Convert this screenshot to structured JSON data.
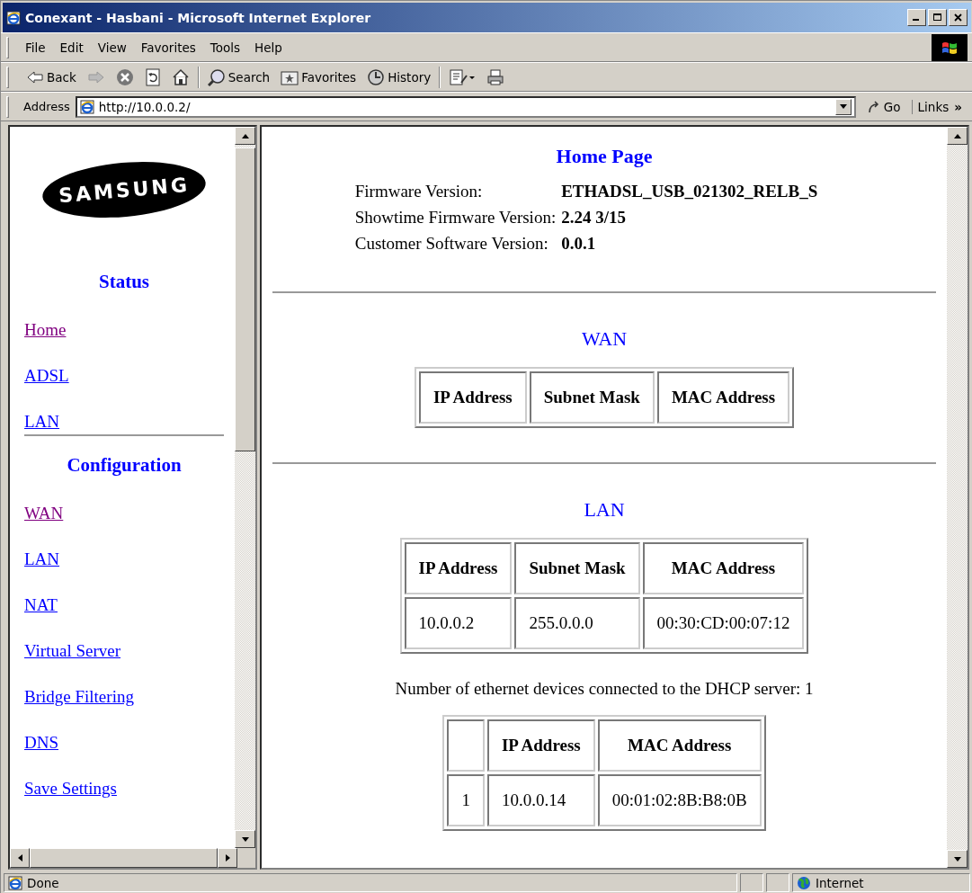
{
  "window": {
    "title": "Conexant - Hasbani - Microsoft Internet Explorer"
  },
  "menu": [
    "File",
    "Edit",
    "View",
    "Favorites",
    "Tools",
    "Help"
  ],
  "toolbar": [
    {
      "kind": "back",
      "label": "Back"
    },
    {
      "kind": "forward"
    },
    {
      "kind": "stop"
    },
    {
      "kind": "refresh"
    },
    {
      "kind": "home"
    },
    {
      "kind": "search",
      "label": "Search"
    },
    {
      "kind": "favorites",
      "label": "Favorites"
    },
    {
      "kind": "history",
      "label": "History"
    },
    {
      "kind": "edit"
    },
    {
      "kind": "print"
    }
  ],
  "address": {
    "label": "Address",
    "value": "http://10.0.0.2/",
    "go": "Go",
    "links": "Links",
    "links_chevron": "»"
  },
  "sidebar": {
    "logo": "SAMSUNG",
    "sections": [
      {
        "heading": "Status",
        "items": [
          {
            "label": "Home",
            "visited": true
          },
          {
            "label": "ADSL",
            "visited": false
          },
          {
            "label": "LAN",
            "visited": false
          }
        ]
      },
      {
        "heading": "Configuration",
        "items": [
          {
            "label": "WAN",
            "visited": true
          },
          {
            "label": "LAN",
            "visited": false
          },
          {
            "label": "NAT",
            "visited": false
          },
          {
            "label": "Virtual Server",
            "visited": false
          },
          {
            "label": "Bridge Filtering",
            "visited": false
          },
          {
            "label": "DNS",
            "visited": false
          },
          {
            "label": "Save Settings",
            "visited": false
          }
        ]
      }
    ]
  },
  "main": {
    "title": "Home Page",
    "info": [
      {
        "label": "Firmware Version:",
        "value": "ETHADSL_USB_021302_RELB_S"
      },
      {
        "label": "Showtime Firmware Version:",
        "value": "2.24 3/15"
      },
      {
        "label": "Customer Software Version:",
        "value": "0.0.1"
      }
    ],
    "sections": [
      {
        "heading": "WAN",
        "tables": [
          {
            "columns": [
              "IP Address",
              "Subnet Mask",
              "MAC Address"
            ]
          }
        ]
      },
      {
        "heading": "LAN",
        "tables": [
          {
            "columns": [
              "IP Address",
              "Subnet Mask",
              "MAC Address"
            ],
            "rows": [
              {
                "cells": [
                  "10.0.0.2",
                  "255.0.0.0",
                  "00:30:CD:00:07:12"
                ]
              }
            ]
          },
          {
            "note": "Number of ethernet devices connected to the DHCP server: 1",
            "columns": [
              "IP Address",
              "MAC Address"
            ],
            "rows": [
              {
                "index": "1",
                "cells": [
                  "10.0.0.14",
                  "00:01:02:8B:B8:0B"
                ]
              }
            ]
          }
        ]
      }
    ]
  },
  "status_bar": {
    "text": "Done",
    "zone": "Internet"
  }
}
